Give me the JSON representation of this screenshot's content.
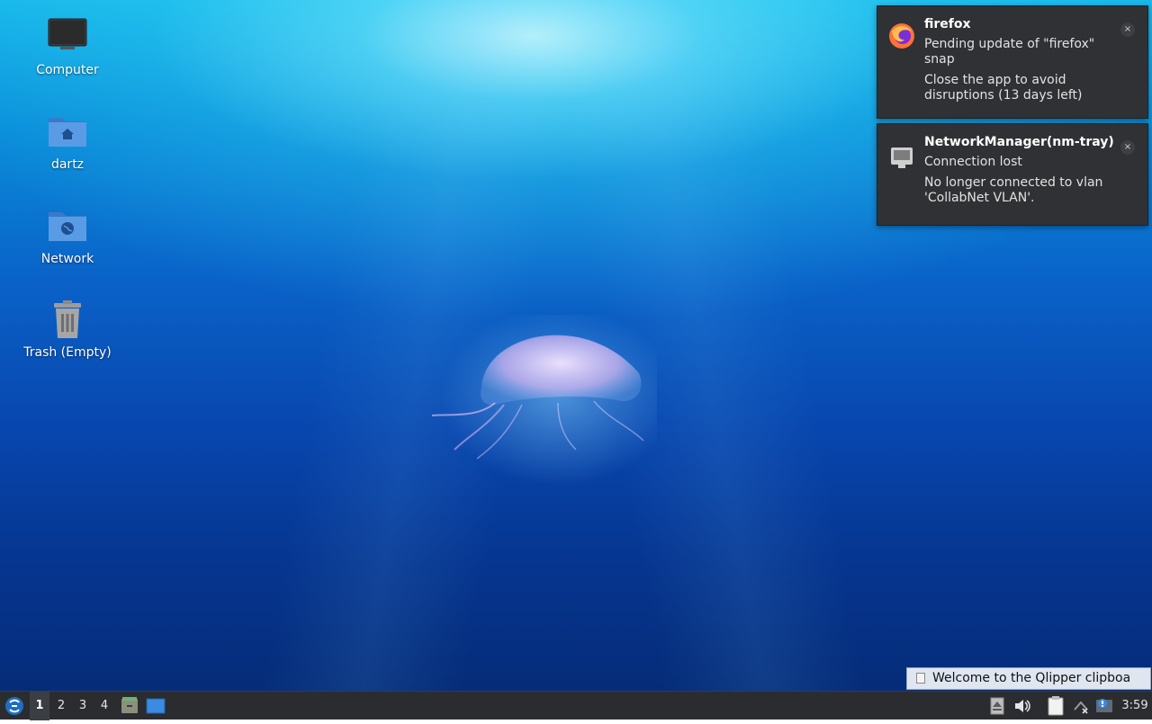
{
  "desktop_icons": [
    {
      "label": "Computer",
      "icon": "monitor-icon"
    },
    {
      "label": "dartz",
      "icon": "home-folder-icon"
    },
    {
      "label": "Network",
      "icon": "network-folder-icon"
    },
    {
      "label": "Trash (Empty)",
      "icon": "trash-icon"
    }
  ],
  "notifications": [
    {
      "app": "firefox",
      "icon": "firefox-icon",
      "summary": "Pending update of \"firefox\" snap",
      "body": "Close the app to avoid disruptions (13 days left)",
      "close": "×"
    },
    {
      "app": "NetworkManager(nm-tray)",
      "icon": "network-wired-icon",
      "summary": "Connection lost",
      "body": "No longer connected to vlan 'CollabNet VLAN'.",
      "close": "×"
    }
  ],
  "tooltip": {
    "text": "Welcome to the Qlipper clipboa"
  },
  "taskbar": {
    "menu_icon": "lubuntu-menu-icon",
    "desktops": [
      "1",
      "2",
      "3",
      "4"
    ],
    "active_desktop": "1",
    "quicklaunch": [
      "file-manager-icon",
      "show-desktop-icon"
    ],
    "tray": [
      "eject-icon",
      "volume-icon",
      "clipboard-icon",
      "network-disconnected-icon",
      "update-notifier-icon"
    ],
    "clock": "3:59"
  },
  "colors": {
    "taskbar_bg": "#2a2c2f",
    "notification_bg": "#2f3134",
    "tooltip_bg": "#dfe6f0",
    "folder_blue": "#4a90e2"
  }
}
